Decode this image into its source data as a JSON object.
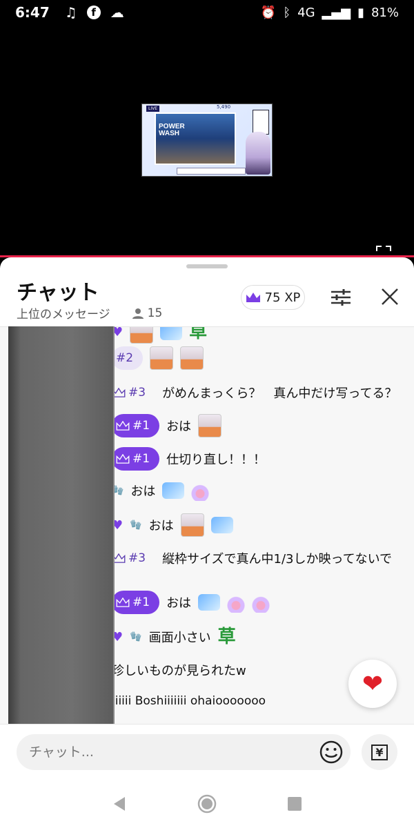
{
  "status": {
    "time": "6:47",
    "network": "4G",
    "battery": "81%"
  },
  "video": {
    "thumb_live": "LIVE",
    "thumb_counter": "5,490",
    "thumb_game_line1": "POWER",
    "thumb_game_line2": "WASH"
  },
  "chat": {
    "title": "チャット",
    "subtitle": "上位のメッセージ",
    "viewer_count": "15",
    "xp": "75 XP",
    "messages": [
      {
        "rank": "",
        "text": "",
        "emotes": [
          "cat",
          "ice",
          "grass"
        ]
      },
      {
        "rank": "#2",
        "text": "",
        "emotes": [
          "cat",
          "cat"
        ]
      },
      {
        "rank": "#3",
        "text": "がめんまっくら？　真ん中だけ写ってる？",
        "emotes": []
      },
      {
        "rank": "#1",
        "text": "おは",
        "emotes": [
          "cat"
        ]
      },
      {
        "rank": "#1",
        "text": "仕切り直し！！！",
        "emotes": []
      },
      {
        "rank": "",
        "text": "おは",
        "emotes": [
          "ice",
          "paw"
        ]
      },
      {
        "rank": "",
        "text": "おは",
        "emotes": [
          "cat",
          "ice"
        ]
      },
      {
        "rank": "#3",
        "text": "縦枠サイズで真ん中1/3しか映ってないで",
        "emotes": []
      },
      {
        "rank": "#1",
        "text": "おは",
        "emotes": [
          "ice",
          "paw",
          "paw"
        ]
      },
      {
        "rank": "",
        "text": "画面小さい",
        "emotes": [
          "grass"
        ]
      },
      {
        "rank": "",
        "text": "珍しいものが見られたw",
        "emotes": []
      },
      {
        "rank": "",
        "text": "iiiiii Boshiiiiiii ohaiooooooo",
        "emotes": []
      }
    ],
    "grass_glyph": "草",
    "input_placeholder": "チャット...",
    "yen_label": "¥"
  },
  "icons": {
    "heart_fab": "heart-icon",
    "emoji": "smiley-icon",
    "tune": "tune-icon",
    "close": "close-icon",
    "crown": "crown-icon",
    "person": "person-icon",
    "fullscreen": "fullscreen-icon"
  },
  "colors": {
    "accent": "#7b3fe4",
    "live_line": "#e8224a",
    "heart": "#e0202a"
  }
}
